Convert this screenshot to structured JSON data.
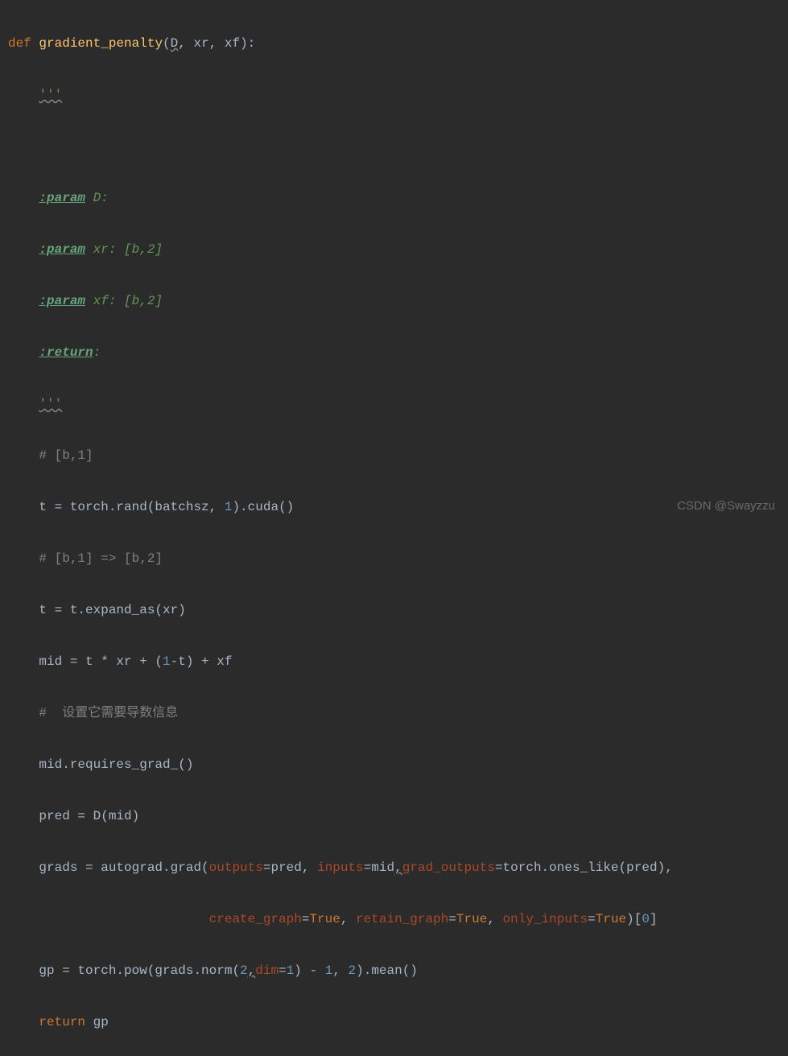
{
  "code": {
    "def_kw": "def",
    "func_name": "gradient_penalty",
    "lparen": "(",
    "param_D": "D",
    "comma1": ", ",
    "param_xr": "xr",
    "comma2": ", ",
    "param_xf": "xf",
    "rparen_colon": "):",
    "tq1": "'''",
    "doc_param1_tag": ":param",
    "doc_param1_rest": " D:",
    "doc_param2_tag": ":param",
    "doc_param2_rest": " xr: [b,2]",
    "doc_param3_tag": ":param",
    "doc_param3_rest": " xf: [b,2]",
    "doc_return_tag": ":return",
    "doc_return_rest": ":",
    "tq2": "'''",
    "c_b1": "# [b,1]",
    "l_t1_a": "t = torch.rand(batchsz",
    "l_t1_comma": ", ",
    "l_t1_num": "1",
    "l_t1_b": ").cuda()",
    "c_b2": "# [b,1] => [b,2]",
    "l_t2": "t = t.expand_as(xr)",
    "l_mid_a": "mid = t * xr + (",
    "l_mid_num": "1",
    "l_mid_b": "-t) + xf",
    "c_cn": "#  设置它需要导数信息",
    "l_req": "mid.requires_grad_()",
    "l_pred": "pred = D(mid)",
    "l_grads_a": "grads = autograd.grad(",
    "l_grads_kw1": "outputs",
    "l_grads_eq": "=",
    "l_grads_v1": "pred",
    "l_grads_c1": ", ",
    "l_grads_kw2": "inputs",
    "l_grads_v2": "mid",
    "l_grads_c2": ",",
    "l_grads_kw3": "grad_outputs",
    "l_grads_v3": "torch.ones_like(pred)",
    "l_grads_c3": ",",
    "l_grads2_kw1": "create_graph",
    "l_grads2_v1": "True",
    "l_grads2_c1": ", ",
    "l_grads2_kw2": "retain_graph",
    "l_grads2_v2": "True",
    "l_grads2_c2": ", ",
    "l_grads2_kw3": "only_inputs",
    "l_grads2_v3": "True",
    "l_grads2_end_a": ")[",
    "l_grads2_idx": "0",
    "l_grads2_end_b": "]",
    "l_gp_a": "gp = torch.pow(grads.norm(",
    "l_gp_n2a": "2",
    "l_gp_comma": ",",
    "l_gp_kw": "dim",
    "l_gp_n1a": "1",
    "l_gp_b": ") - ",
    "l_gp_n1b": "1",
    "l_gp_c": ", ",
    "l_gp_n2b": "2",
    "l_gp_d": ").mean()",
    "l_ret": "return",
    "l_ret_v": " gp"
  },
  "watermark": "CSDN @Swayzzu"
}
